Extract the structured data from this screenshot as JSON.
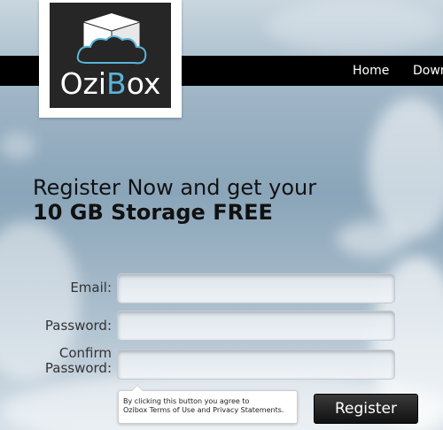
{
  "nav": {
    "items": [
      {
        "label": "Home"
      },
      {
        "label": "Down"
      }
    ]
  },
  "logo": {
    "text_main": "Ozi",
    "text_accent": "B",
    "text_end": "ox"
  },
  "headline": {
    "line1": "Register Now and get your",
    "line2": "10 GB Storage FREE"
  },
  "form": {
    "email_label": "Email:",
    "password_label": "Password:",
    "confirm_label_line1": "Confirm",
    "confirm_label_line2": "Password:",
    "email_value": "",
    "password_value": "",
    "confirm_value": ""
  },
  "terms": {
    "line1": "By clicking this button you agree to",
    "line2": "Ozibox Terms of Use and Privacy Statements."
  },
  "register_button": {
    "label": "Register"
  },
  "colors": {
    "navbar": "#000000",
    "logo_bg": "#262626",
    "logo_accent": "#5ab3d8"
  }
}
